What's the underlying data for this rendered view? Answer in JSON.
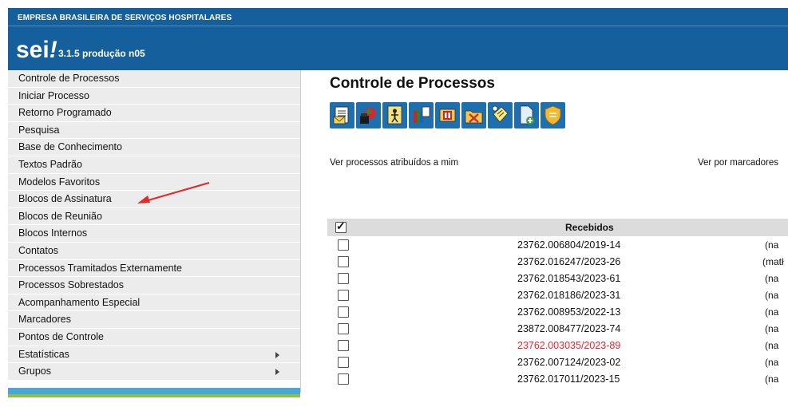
{
  "header": {
    "org": "EMPRESA BRASILEIRA DE SERVIÇOS HOSPITALARES",
    "logo": "sei",
    "logo_mark": "!",
    "version": "3.1.5 produção n05"
  },
  "sidebar": {
    "items": [
      {
        "label": "Controle de Processos"
      },
      {
        "label": "Iniciar Processo"
      },
      {
        "label": "Retorno Programado"
      },
      {
        "label": "Pesquisa"
      },
      {
        "label": "Base de Conhecimento"
      },
      {
        "label": "Textos Padrão"
      },
      {
        "label": "Modelos Favoritos"
      },
      {
        "label": "Blocos de Assinatura"
      },
      {
        "label": "Blocos de Reunião"
      },
      {
        "label": "Blocos Internos"
      },
      {
        "label": "Contatos"
      },
      {
        "label": "Processos Tramitados Externamente"
      },
      {
        "label": "Processos Sobrestados"
      },
      {
        "label": "Acompanhamento Especial"
      },
      {
        "label": "Marcadores"
      },
      {
        "label": "Pontos de Controle"
      },
      {
        "label": "Estatísticas",
        "submenu": true
      },
      {
        "label": "Grupos",
        "submenu": true
      }
    ]
  },
  "main": {
    "title": "Controle de Processos",
    "toolbar_icons": [
      "new-document-icon",
      "send-process-icon",
      "assign-icon",
      "documents-icon",
      "sobrestar-icon",
      "close-process-icon",
      "annotation-icon",
      "new-process-icon",
      "security-icon"
    ],
    "link_assigned": "Ver processos atribuídos a mim",
    "link_markers": "Ver por marcadores",
    "table": {
      "header": "Recebidos",
      "header_checked": true,
      "rows": [
        {
          "number": "23762.006804/2019-14",
          "extra": "(na",
          "red": false
        },
        {
          "number": "23762.016247/2023-26",
          "extra": "(matł",
          "red": false
        },
        {
          "number": "23762.018543/2023-61",
          "extra": "(na",
          "red": false
        },
        {
          "number": "23762.018186/2023-31",
          "extra": "(na",
          "red": false
        },
        {
          "number": "23762.008953/2022-13",
          "extra": "(na",
          "red": false
        },
        {
          "number": "23872.008477/2023-74",
          "extra": "(na",
          "red": false
        },
        {
          "number": "23762.003035/2023-89",
          "extra": "(na",
          "red": true
        },
        {
          "number": "23762.007124/2023-02",
          "extra": "(na",
          "red": false
        },
        {
          "number": "23762.017011/2023-15",
          "extra": "(na",
          "red": false
        }
      ]
    }
  },
  "colors": {
    "header_blue": "#155f9d",
    "toolbar_blue": "#1d6fb0",
    "sidebar_bg": "#ececec",
    "red_link": "#e8262d",
    "arrow_red": "#e32b2b"
  }
}
